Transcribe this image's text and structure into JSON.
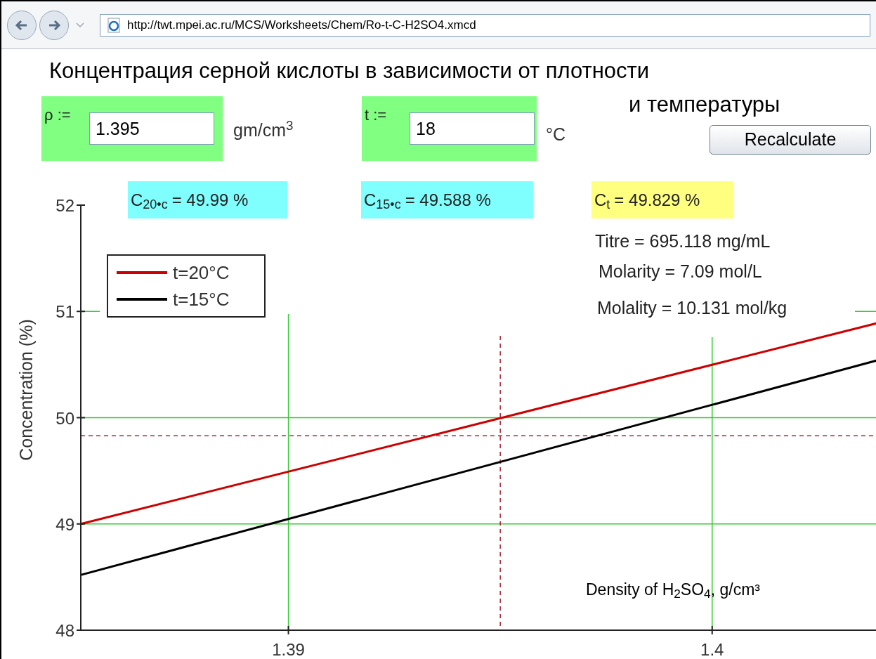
{
  "browser": {
    "address": "http://twt.mpei.ac.ru/MCS/Worksheets/Chem/Ro-t-C-H2SO4.xmcd"
  },
  "worksheet": {
    "title_lines": [
      "Концентрация серной кислоты в зависимости от плотности",
      "и температуры"
    ],
    "inputs": [
      {
        "label": "ρ :=",
        "value": "1.395",
        "unit": "gm/cm$^{3}$"
      },
      {
        "label": "t :=",
        "value": "18",
        "unit": "°C"
      }
    ],
    "button": "Recalculate",
    "results": [
      {
        "name": "C$_{20•c}$",
        "value": "= 49.99 %",
        "color": "#80ffff"
      },
      {
        "name": "C$_{15•c}$",
        "value": "= 49.588 %",
        "color": "#80ffff"
      },
      {
        "name": "C$_{t}$",
        "value": "= 49.829 %",
        "color": "#ffff80"
      }
    ],
    "details": [
      "Titre = 695.118 mg/mL",
      "Molarity = 7.09 mol/L",
      "Molality = 10.131 mol/kg"
    ],
    "chart_data": {
      "type": "line",
      "xlabel": "Density of H$_{2}$SO$_{4}$, g/cm³",
      "ylabel": "Concentration (%)",
      "x": [
        1.3851,
        1.4039
      ],
      "series": [
        {
          "name": "t=20°C",
          "color": "#cc0000",
          "values": [
            49.0,
            50.89
          ]
        },
        {
          "name": "t=15°C",
          "color": "#000000",
          "values": [
            48.52,
            50.54
          ]
        }
      ],
      "xlim": [
        1.3851,
        1.4039
      ],
      "ylim": [
        48,
        52
      ],
      "xticks": [
        1.39,
        1.4
      ],
      "yticks": [
        48,
        49,
        50,
        51,
        52
      ],
      "grid": true,
      "ref_lines": [
        {
          "axis": "x",
          "value": 1.395
        },
        {
          "axis": "y",
          "value": 49.829
        }
      ]
    }
  }
}
